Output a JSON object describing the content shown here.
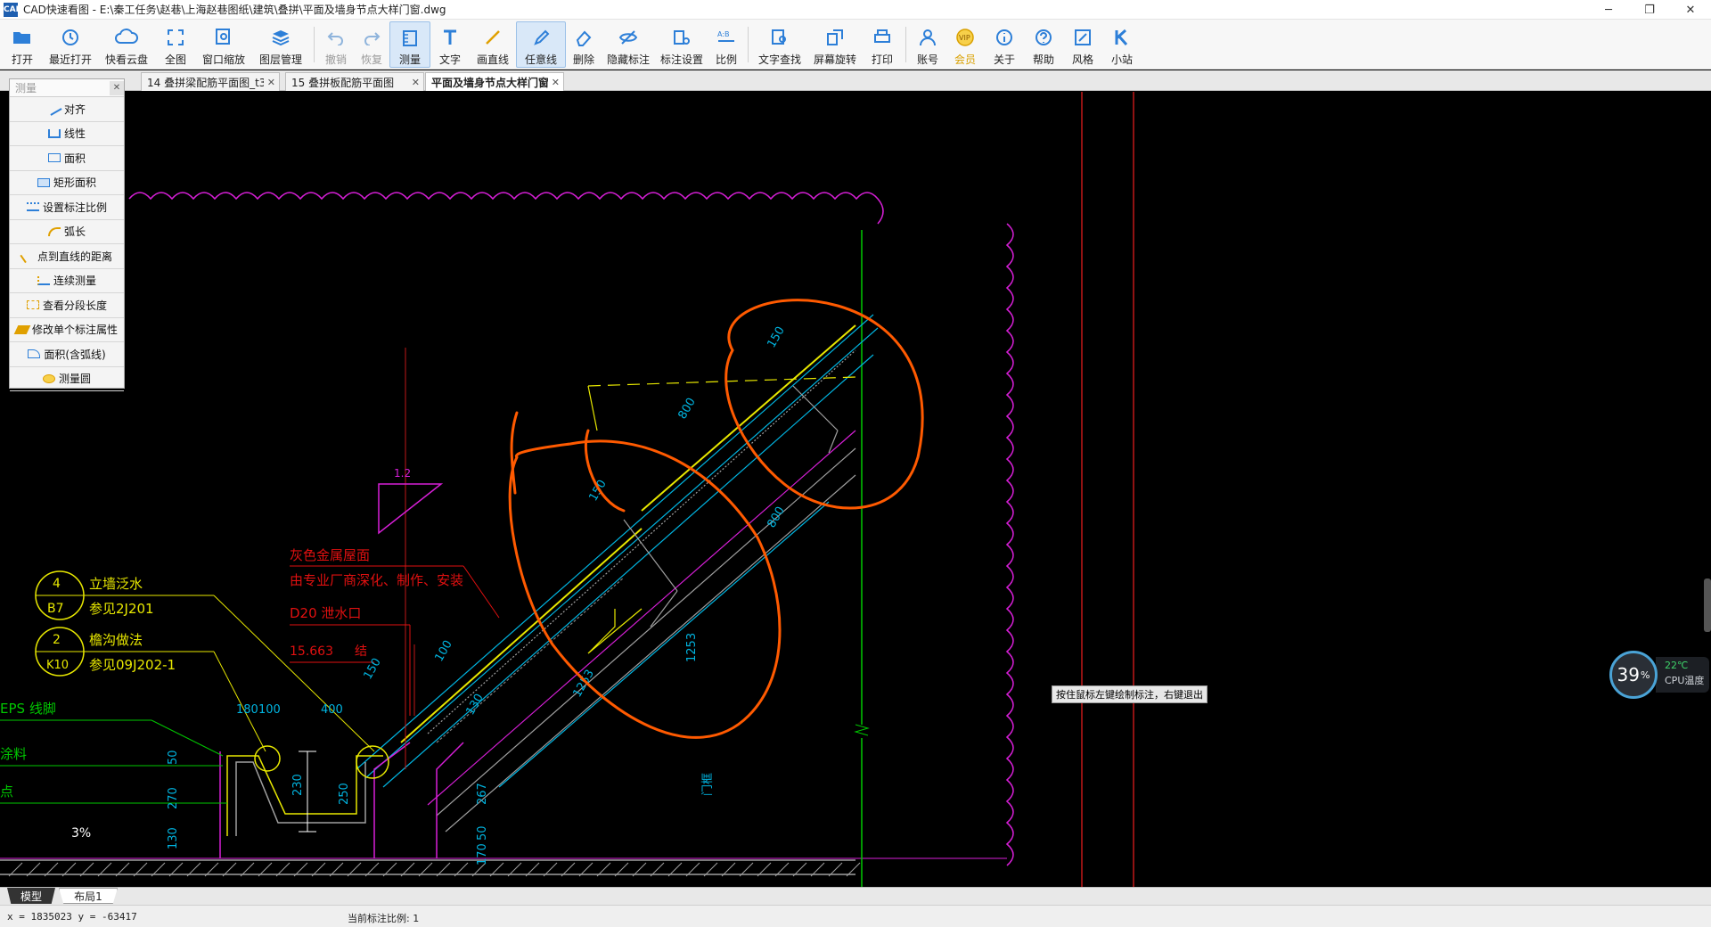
{
  "window": {
    "title": "CAD快速看图 - E:\\秦工任务\\赵巷\\上海赵巷图纸\\建筑\\叠拼\\平面及墙身节点大样门窗.dwg",
    "logo": "CAD",
    "controls": [
      "─",
      "❐",
      "✕"
    ]
  },
  "toolbar": {
    "open": "打开",
    "recent": "最近打开",
    "cloud": "快看云盘",
    "full": "全图",
    "window_zoom": "窗口缩放",
    "layers": "图层管理",
    "undo": "撤销",
    "redo": "恢复",
    "measure": "测量",
    "text": "文字",
    "line": "画直线",
    "freehand": "任意线",
    "delete": "删除",
    "hide_dim": "隐藏标注",
    "dim_settings": "标注设置",
    "ratio": "比例",
    "find_text": "文字查找",
    "rotate": "屏幕旋转",
    "print": "打印",
    "account": "账号",
    "vip": "会员",
    "about": "关于",
    "help": "帮助",
    "style": "风格",
    "station": "小站"
  },
  "tabs": [
    {
      "label": "14  叠拼梁配筋平面图_t3"
    },
    {
      "label": "15  叠拼板配筋平面图"
    },
    {
      "label": "平面及墙身节点大样门窗"
    }
  ],
  "measure_panel": {
    "title": "测量",
    "items": [
      "对齐",
      "线性",
      "面积",
      "矩形面积",
      "设置标注比例",
      "弧长",
      "点到直线的距离",
      "连续测量",
      "查看分段长度",
      "修改单个标注属性",
      "面积(含弧线)",
      "测量圆"
    ]
  },
  "drawing": {
    "callout1_num": "4",
    "callout1_ref": "B7",
    "callout1_title": "立墙泛水",
    "callout1_sub": "参见2J201",
    "callout2_num": "2",
    "callout2_ref": "K10",
    "callout2_title": "檐沟做法",
    "callout2_sub": "参见09J202-1",
    "note1": "灰色金属屋面",
    "note2": "由专业厂商深化、制作、安装",
    "note3": "D20  泄水口",
    "note4": "15.663",
    "note4b": "结",
    "slope": "1.2",
    "eps": "EPS  线脚",
    "coating": "涂料",
    "point": "点",
    "pct": "3%",
    "dims": [
      "150",
      "800",
      "150",
      "800",
      "1253",
      "1253",
      "门框",
      "180",
      "100",
      "400",
      "50",
      "270",
      "130",
      "230",
      "250",
      "267",
      "50",
      "170",
      "150",
      "100",
      "130"
    ]
  },
  "hint": "按住鼠标左键绘制标注，右键退出",
  "cpu": {
    "percent": "39",
    "unit": "%",
    "temp": "22℃",
    "label": "CPU温度"
  },
  "layout_tabs": {
    "model": "模型",
    "layout1": "布局1"
  },
  "status": {
    "coords": "x = 1835023  y = -63417",
    "scale": "当前标注比例: 1"
  },
  "colors": {
    "canvas": "#000000",
    "magenta": "#d81fd8",
    "orange": "#ff5a00",
    "yellow": "#e8e800",
    "cyan": "#00b4e0",
    "green": "#00c800",
    "red": "#e01010"
  }
}
